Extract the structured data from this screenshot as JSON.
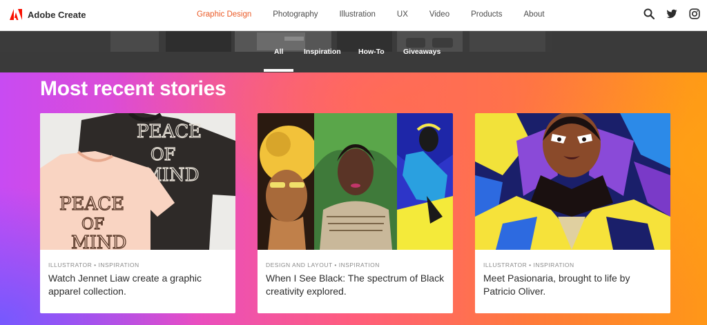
{
  "brand": {
    "name": "Adobe Create"
  },
  "nav": {
    "items": [
      {
        "label": "Graphic Design",
        "active": true
      },
      {
        "label": "Photography"
      },
      {
        "label": "Illustration"
      },
      {
        "label": "UX"
      },
      {
        "label": "Video"
      },
      {
        "label": "Products"
      },
      {
        "label": "About"
      }
    ],
    "icons": [
      "search-icon",
      "twitter-icon",
      "instagram-icon"
    ],
    "active_color": "#eb5a26"
  },
  "subnav": {
    "tabs": [
      {
        "label": "All",
        "active": true
      },
      {
        "label": "Inspiration"
      },
      {
        "label": "How-To"
      },
      {
        "label": "Giveaways"
      }
    ]
  },
  "section": {
    "title": "Most recent stories"
  },
  "cards": [
    {
      "category": "ILLUSTRATOR • INSPIRATION",
      "title": "Watch Jennet Liaw create a graphic apparel collection."
    },
    {
      "category": "DESIGN AND LAYOUT • INSPIRATION",
      "title": "When I See Black: The spectrum of Black creativity explored."
    },
    {
      "category": "ILLUSTRATOR • INSPIRATION",
      "title": "Meet Pasionaria, brought to life by Patricio Oliver."
    }
  ]
}
